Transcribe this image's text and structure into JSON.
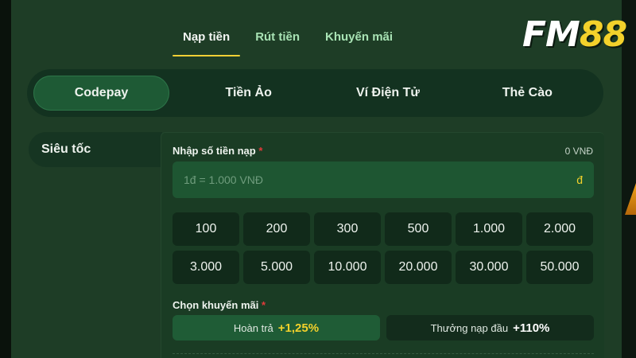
{
  "top_tabs": [
    {
      "label": "Nạp tiền",
      "active": true
    },
    {
      "label": "Rút tiền",
      "active": false
    },
    {
      "label": "Khuyến mãi",
      "active": false
    }
  ],
  "logo": {
    "text_a": "FM",
    "text_b": "88"
  },
  "methods": [
    {
      "label": "Codepay",
      "active": true
    },
    {
      "label": "Tiền Ảo",
      "active": false
    },
    {
      "label": "Ví Điện Tử",
      "active": false
    },
    {
      "label": "Thẻ Cào",
      "active": false
    }
  ],
  "sub_menu": {
    "item": "Siêu tốc"
  },
  "form": {
    "amount_label": "Nhập số tiền nạp",
    "required_mark": "*",
    "balance": "0 VNĐ",
    "amount_placeholder": "1đ = 1.000 VNĐ",
    "currency_symbol": "đ",
    "amounts": [
      "100",
      "200",
      "300",
      "500",
      "1.000",
      "2.000",
      "3.000",
      "5.000",
      "10.000",
      "20.000",
      "30.000",
      "50.000"
    ],
    "promo_label": "Chọn khuyến mãi",
    "promos": [
      {
        "title": "Hoàn trả",
        "value": "+1,25%",
        "selected": true
      },
      {
        "title": "Thưởng nạp đầu",
        "value": "+110%",
        "selected": false
      }
    ]
  },
  "colors": {
    "panel": "#1e3d26",
    "accent_yellow": "#f3cf35",
    "required_red": "#e23a3a"
  }
}
